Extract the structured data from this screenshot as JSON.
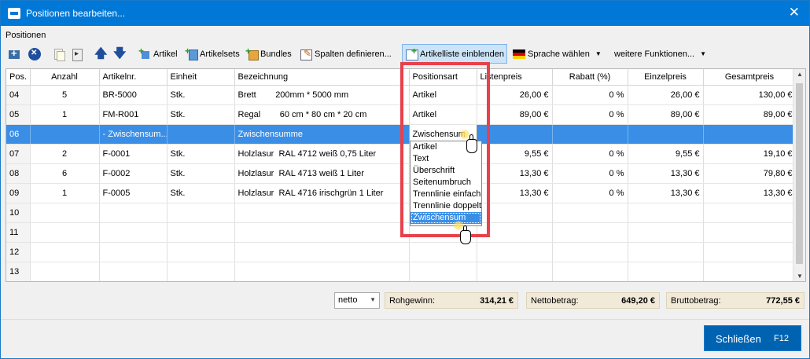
{
  "window": {
    "title": "Positionen bearbeiten...",
    "close_glyph": "✕"
  },
  "section_label": "Positionen",
  "toolbar": {
    "artikel": "Artikel",
    "artikelsets": "Artikelsets",
    "bundles": "Bundles",
    "spalten": "Spalten definieren...",
    "artikelliste": "Artikelliste einblenden",
    "sprache": "Sprache wählen",
    "weitere": "weitere Funktionen..."
  },
  "grid": {
    "columns": [
      "Pos.",
      "Anzahl",
      "Artikelnr.",
      "Einheit",
      "Bezeichnung",
      "Positionsart",
      "Listenpreis",
      "Rabatt (%)",
      "Einzelpreis",
      "Gesamtpreis"
    ],
    "rows": [
      {
        "pos": "04",
        "anzahl": "5",
        "artikelnr": "BR-5000",
        "einheit": "Stk.",
        "bez1": "Brett",
        "bez2": "200mm * 5000 mm",
        "art": "Artikel",
        "liste": "26,00 €",
        "rabatt": "0 %",
        "einzel": "26,00 €",
        "gesamt": "130,00 €"
      },
      {
        "pos": "05",
        "anzahl": "1",
        "artikelnr": "FM-R001",
        "einheit": "Stk.",
        "bez1": "Regal",
        "bez2": "60 cm * 80 cm * 20 cm",
        "art": "Artikel",
        "liste": "89,00 €",
        "rabatt": "0 %",
        "einzel": "89,00 €",
        "gesamt": "89,00 €"
      },
      {
        "pos": "06",
        "anzahl": "",
        "artikelnr": "- Zwischensum...",
        "einheit": "",
        "bez1": "Zwischensumme",
        "bez2": "",
        "art": "Zwischensum",
        "liste": "",
        "rabatt": "",
        "einzel": "",
        "gesamt": ""
      },
      {
        "pos": "07",
        "anzahl": "2",
        "artikelnr": "F-0001",
        "einheit": "Stk.",
        "bez1": "Holzlasur",
        "bez2": "RAL 4712 weiß 0,75 Liter",
        "art": "",
        "liste": "9,55 €",
        "rabatt": "0 %",
        "einzel": "9,55 €",
        "gesamt": "19,10 €"
      },
      {
        "pos": "08",
        "anzahl": "6",
        "artikelnr": "F-0002",
        "einheit": "Stk.",
        "bez1": "Holzlasur",
        "bez2": "RAL 4713 weiß 1 Liter",
        "art": "",
        "liste": "13,30 €",
        "rabatt": "0 %",
        "einzel": "13,30 €",
        "gesamt": "79,80 €"
      },
      {
        "pos": "09",
        "anzahl": "1",
        "artikelnr": "F-0005",
        "einheit": "Stk.",
        "bez1": "Holzlasur",
        "bez2": "RAL 4716 irischgrün 1 Liter",
        "art": "",
        "liste": "13,30 €",
        "rabatt": "0 %",
        "einzel": "13,30 €",
        "gesamt": "13,30 €"
      },
      {
        "pos": "10"
      },
      {
        "pos": "11"
      },
      {
        "pos": "12"
      },
      {
        "pos": "13"
      }
    ]
  },
  "dropdown": {
    "options": [
      "Artikel",
      "Text",
      "Überschrift",
      "Seitenumbruch",
      "Trennlinie einfach",
      "Trennlinie doppelt",
      "Zwischensum"
    ],
    "selected_index": 6
  },
  "footer": {
    "mode": "netto",
    "rohgewinn_label": "Rohgewinn:",
    "rohgewinn": "314,21 €",
    "netto_label": "Nettobetrag:",
    "netto": "649,20 €",
    "brutto_label": "Bruttobetrag:",
    "brutto": "772,55 €",
    "close_label": "Schließen",
    "close_key": "F12"
  },
  "colors": {
    "titlebar": "#0078d7",
    "selection": "#3a8ee6",
    "highlight": "#e8414b",
    "button": "#0063b1"
  }
}
